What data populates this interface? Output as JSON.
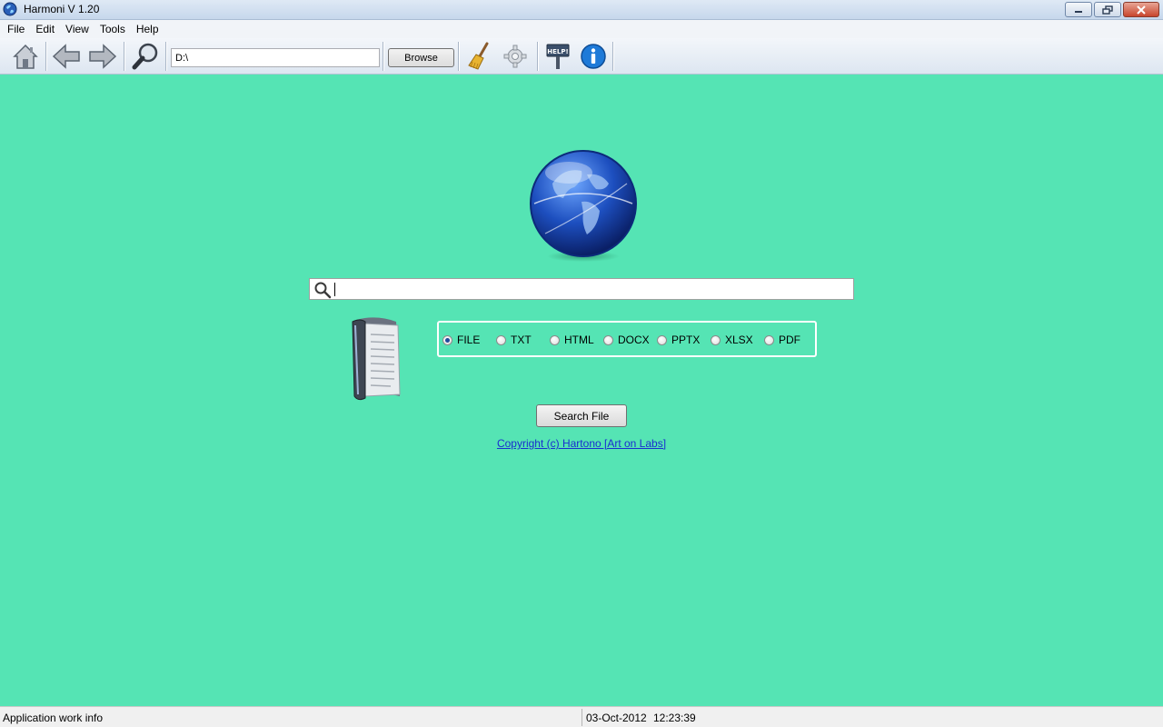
{
  "window": {
    "title": "Harmoni V 1.20"
  },
  "menu": {
    "items": [
      "File",
      "Edit",
      "View",
      "Tools",
      "Help"
    ]
  },
  "toolbar": {
    "path_value": "D:\\",
    "browse_label": "Browse",
    "icons": [
      "home-icon",
      "back-arrow-icon",
      "forward-arrow-icon",
      "magnifier-icon",
      "broom-icon",
      "gear-icon",
      "help-sign-icon",
      "info-icon"
    ]
  },
  "search": {
    "value": "",
    "placeholder": ""
  },
  "file_types": {
    "options": [
      "FILE",
      "TXT",
      "HTML",
      "DOCX",
      "PPTX",
      "XLSX",
      "PDF"
    ],
    "selected": "FILE"
  },
  "search_button": {
    "label": "Search File"
  },
  "copyright": {
    "text": "Copyright (c) Hartono [Art on Labs]"
  },
  "status": {
    "info": "Application work info",
    "date": "03-Oct-2012",
    "time": "12:23:39"
  },
  "colors": {
    "background": "#55e4b4",
    "link": "#1a2ecf"
  }
}
